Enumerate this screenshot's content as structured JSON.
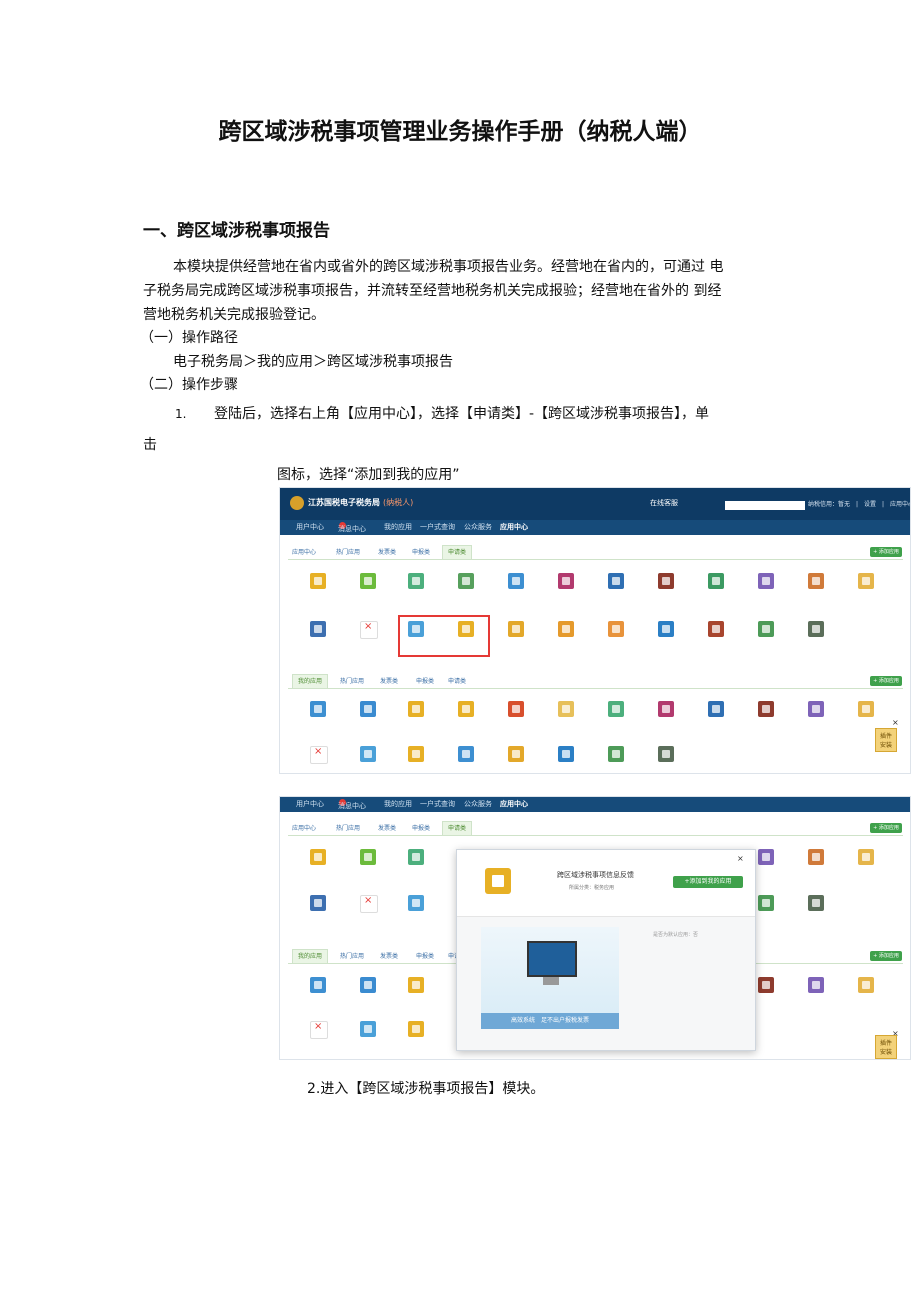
{
  "doc": {
    "title": "跨区域涉税事项管理业务操作手册（纳税人端）",
    "section1": "一、跨区域涉税事项报告",
    "para1_l1": "本模块提供经营地在省内或省外的跨区域涉税事项报告业务。经营地在省内的，可通过 电",
    "para1_l2": "子税务局完成跨区域涉税事项报告，并流转至经营地税务机关完成报验；经营地在省外的 到经",
    "para1_l3": "营地税务机关完成报验登记。",
    "sub1": "（一）操作路径",
    "path": "电子税务局＞我的应用＞跨区域涉税事项报告",
    "sub2": "（二）操作步骤",
    "step1_num": "1.",
    "step1_text": "登陆后，选择右上角【应用中心】，选择【申请类】-【跨区域涉税事项报告】，单",
    "step1_cont": "击",
    "step1_tail": "图标，选择“添加到我的应用”",
    "step2": "2.进入【跨区域涉税事项报告】模块。"
  },
  "screen1": {
    "header_title": "江苏国税电子税务局",
    "header_sub": "(纳税人)",
    "online": "在线客服",
    "header_right": "纳税信用：暂无　|　设置　|　应用中心　|　退出",
    "nav": [
      "用户中心",
      "消息中心",
      "我的应用",
      "一户式查询",
      "公众服务",
      "应用中心"
    ],
    "top_tabs": [
      "应用中心",
      "热门应用",
      "发票类",
      "申报类",
      "申请类"
    ],
    "top_btn": "+ 添加应用",
    "my_tabs": [
      "我的应用",
      "热门应用",
      "发票类",
      "申报类",
      "申请类"
    ],
    "my_btn": "+ 添加应用",
    "side_label": "插件\n安装",
    "close": "×"
  },
  "screen2": {
    "nav": [
      "用户中心",
      "消息中心",
      "我的应用",
      "一户式查询",
      "公众服务",
      "应用中心"
    ],
    "top_tabs": [
      "应用中心",
      "热门应用",
      "发票类",
      "申报类",
      "申请类"
    ],
    "top_btn": "+ 添加应用",
    "my_tabs": [
      "我的应用",
      "热门应用",
      "发票类",
      "申报类",
      "申请类"
    ],
    "my_btn": "+ 添加应用",
    "side_label": "插件\n安装",
    "close": "×",
    "modal": {
      "title": "跨区域涉税事项信息反馈",
      "sub": "所属分类：税务应用",
      "add_btn": "+添加到我的应用",
      "close": "×",
      "note": "是否为默认应用：否",
      "banner": "高效系统　足不出户报税发票"
    }
  },
  "colors": {
    "header": "#0e3a64",
    "nav": "#164b7a",
    "green": "#3fa14b",
    "highlight": "#e53935"
  }
}
